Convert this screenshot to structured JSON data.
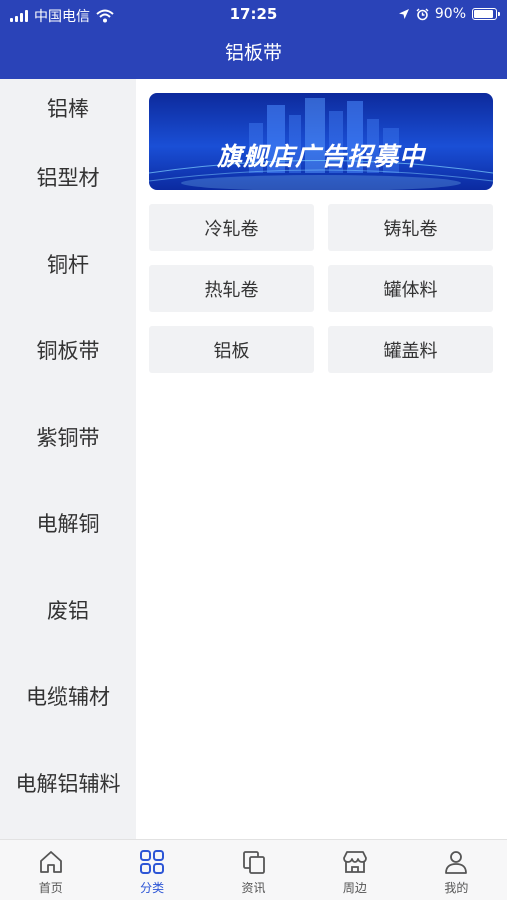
{
  "status_bar": {
    "carrier": "中国电信",
    "time": "17:25",
    "battery": "90%"
  },
  "nav": {
    "title": "铝板带"
  },
  "sidebar": {
    "items": [
      {
        "label": "铝棒"
      },
      {
        "label": "铝型材"
      },
      {
        "label": "铜杆"
      },
      {
        "label": "铜板带"
      },
      {
        "label": "紫铜带"
      },
      {
        "label": "电解铜"
      },
      {
        "label": "废铝"
      },
      {
        "label": "电缆辅材"
      },
      {
        "label": "电解铝辅料"
      }
    ]
  },
  "banner": {
    "text": "旗舰店广告招募中"
  },
  "subcategories": [
    {
      "label": "冷轧卷"
    },
    {
      "label": "铸轧卷"
    },
    {
      "label": "热轧卷"
    },
    {
      "label": "罐体料"
    },
    {
      "label": "铝板"
    },
    {
      "label": "罐盖料"
    }
  ],
  "tabbar": {
    "tabs": [
      {
        "label": "首页",
        "icon": "home-icon"
      },
      {
        "label": "分类",
        "icon": "category-icon",
        "active": true
      },
      {
        "label": "资讯",
        "icon": "news-icon"
      },
      {
        "label": "周边",
        "icon": "store-icon"
      },
      {
        "label": "我的",
        "icon": "user-icon"
      }
    ]
  },
  "colors": {
    "header_bg": "#2a43b8",
    "active_tab": "#2d56d6",
    "sidebar_bg": "#f1f2f4"
  }
}
